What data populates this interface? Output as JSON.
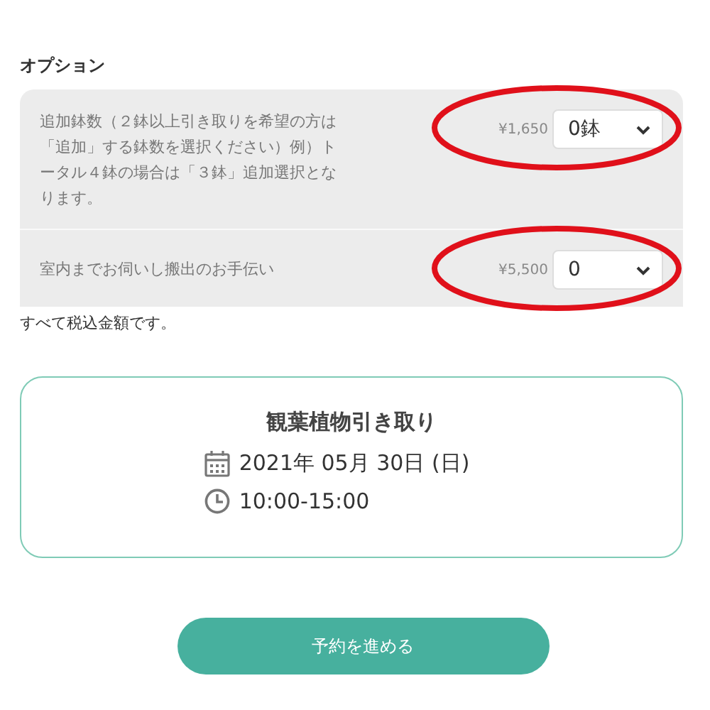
{
  "section_title": "オプション",
  "options": [
    {
      "description": "追加鉢数（２鉢以上引き取りを希望の方は「追加」する鉢数を選択ください）例）トータル４鉢の場合は「３鉢」追加選択となります。",
      "price": "¥1,650",
      "value": "0鉢",
      "circled": true
    },
    {
      "description": "室内までお伺いし搬出のお手伝い",
      "price": "¥5,500",
      "value": "0",
      "circled": true
    }
  ],
  "tax_note": "すべて税込金額です。",
  "summary": {
    "title": "観葉植物引き取り",
    "date": "2021年 05月 30日 (日)",
    "time": "10:00-15:00"
  },
  "submit_button": "予約を進める"
}
